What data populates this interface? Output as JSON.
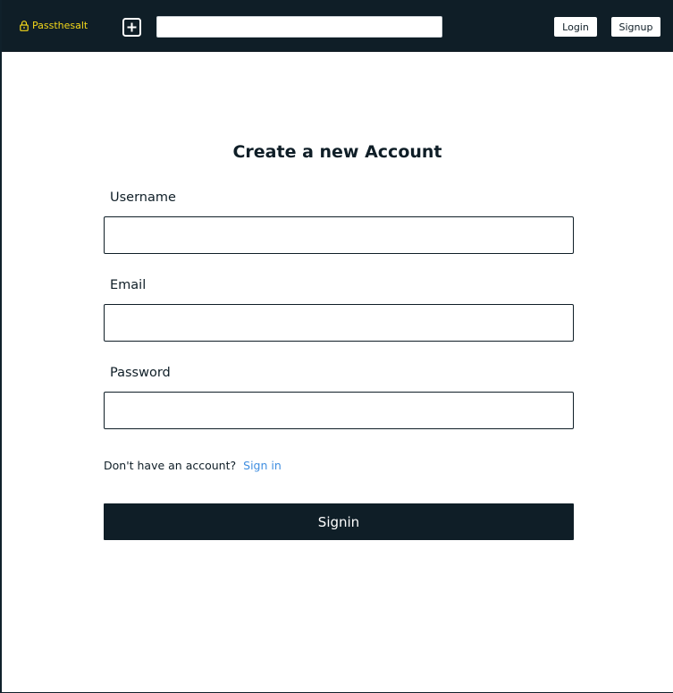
{
  "navbar": {
    "brand_icon": "lock-icon",
    "brand_name": "Passthesalt",
    "add_icon": "plus-square-icon",
    "search": {
      "value": "",
      "placeholder": ""
    },
    "login_label": "Login",
    "signup_label": "Signup"
  },
  "form": {
    "title": "Create a new Account",
    "username_label": "Username",
    "username_value": "",
    "email_label": "Email",
    "email_value": "",
    "password_label": "Password",
    "password_value": "",
    "account_prompt": "Don't have an account?",
    "signin_link": "Sign in",
    "submit_label": "Signin"
  },
  "colors": {
    "navbar_bg": "#0f1e27",
    "brand": "#f4d81a",
    "link": "#3f8ee0",
    "button_bg": "#0f1e27"
  }
}
